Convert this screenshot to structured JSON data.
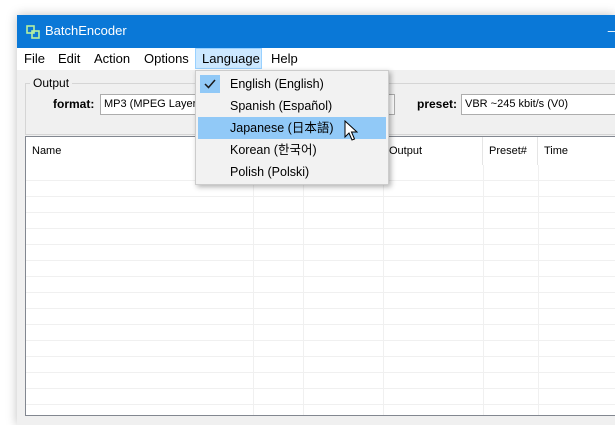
{
  "window": {
    "title": "BatchEncoder"
  },
  "menu": [
    {
      "label": "File"
    },
    {
      "label": "Edit"
    },
    {
      "label": "Action"
    },
    {
      "label": "Options"
    },
    {
      "label": "Language"
    },
    {
      "label": "Help"
    }
  ],
  "output_group": {
    "label": "Output",
    "format_label": "format:",
    "format_value": "MP3 (MPEG Layer-3)",
    "preset_label": "preset:",
    "preset_value": "VBR ~245 kbit/s (V0)"
  },
  "list": {
    "columns": [
      {
        "label": "Name"
      },
      {
        "label": ""
      },
      {
        "label": ""
      },
      {
        "label": "Output"
      },
      {
        "label": "Preset#"
      },
      {
        "label": "Time"
      }
    ]
  },
  "language_menu": {
    "items": [
      {
        "label": "English (English)",
        "checked": true
      },
      {
        "label": "Spanish (Español)",
        "checked": false
      },
      {
        "label": "Japanese (日本語)",
        "checked": false,
        "highlighted": true
      },
      {
        "label": "Korean (한국어)",
        "checked": false
      },
      {
        "label": "Polish (Polski)",
        "checked": false
      }
    ]
  },
  "colors": {
    "titlebar": "#0a78d7",
    "highlight": "#91c9f7",
    "menu_active": "#cce8ff"
  }
}
